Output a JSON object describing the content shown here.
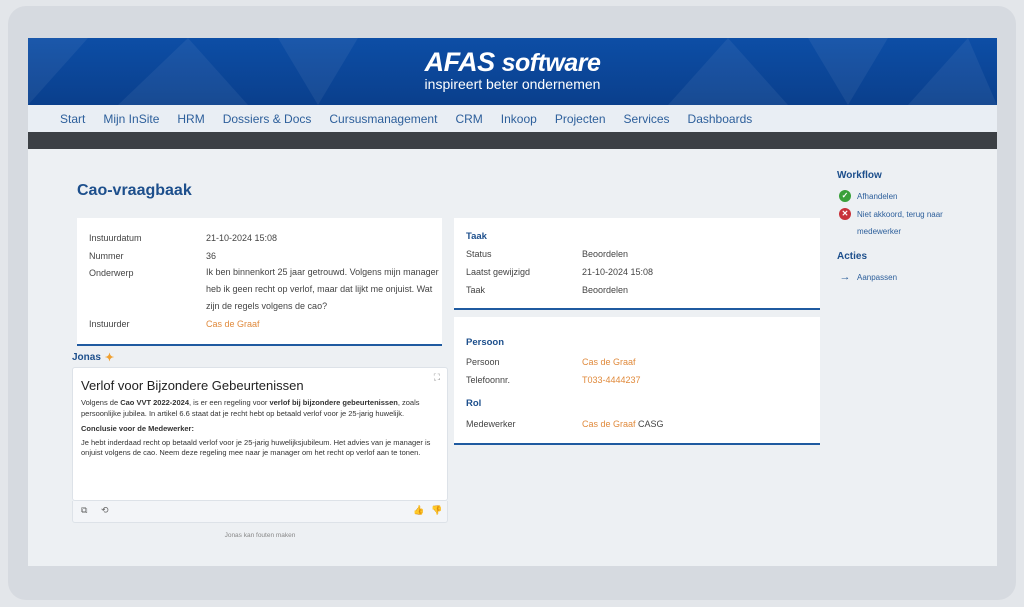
{
  "brand": {
    "name": "AFAS",
    "software": "software",
    "tagline": "inspireert beter ondernemen"
  },
  "nav": [
    "Start",
    "Mijn InSite",
    "HRM",
    "Dossiers & Docs",
    "Cursusmanagement",
    "CRM",
    "Inkoop",
    "Projecten",
    "Services",
    "Dashboards"
  ],
  "page": {
    "title": "Cao-vraagbaak"
  },
  "request": {
    "instuurdatum_label": "Instuurdatum",
    "instuurdatum": "21-10-2024 15:08",
    "nummer_label": "Nummer",
    "nummer": "36",
    "onderwerp_label": "Onderwerp",
    "onderwerp": "Ik ben binnenkort 25 jaar getrouwd. Volgens mijn manager heb ik geen recht op verlof, maar dat lijkt me onjuist. Wat zijn de regels volgens de cao?",
    "instuurder_label": "Instuurder",
    "instuurder": "Cas de Graaf"
  },
  "taak": {
    "title": "Taak",
    "status_label": "Status",
    "status": "Beoordelen",
    "gewijzigd_label": "Laatst gewijzigd",
    "gewijzigd": "21-10-2024 15:08",
    "taak_label": "Taak",
    "taak": "Beoordelen"
  },
  "persoon": {
    "title": "Persoon",
    "persoon_label": "Persoon",
    "persoon": "Cas de Graaf",
    "telefoon_label": "Telefoonnr.",
    "telefoon": "T033-4444237",
    "rol_title": "Rol",
    "medewerker_label": "Medewerker",
    "medewerker": "Cas de Graaf",
    "medewerker_code": "CASG"
  },
  "jonas": {
    "label": "Jonas",
    "heading": "Verlof voor Bijzondere Gebeurtenissen",
    "p1_a": "Volgens de ",
    "p1_b": "Cao VVT 2022-2024",
    "p1_c": ", is er een regeling voor ",
    "p1_d": "verlof bij bijzondere gebeurtenissen",
    "p1_e": ", zoals persoonlijke jubilea. In artikel 6.6 staat dat je recht hebt op betaald verlof voor je 25-jarig huwelijk.",
    "conclusion_title": "Conclusie voor de Medewerker:",
    "conclusion": "Je hebt inderdaad recht op betaald verlof voor je 25-jarig huwelijksjubileum. Het advies van je manager is onjuist volgens de cao. Neem deze regeling mee naar je manager om het recht op verlof aan te tonen.",
    "disclaimer": "Jonas kan fouten maken"
  },
  "workflow": {
    "title": "Workflow",
    "afhandelen": "Afhandelen",
    "niet_akkoord": "Niet akkoord, terug naar medewerker"
  },
  "acties": {
    "title": "Acties",
    "aanpassen": "Aanpassen"
  },
  "colors": {
    "brand_blue": "#0d4ea6",
    "link_orange": "#e08a3c",
    "success_green": "#3aa03a",
    "error_red": "#c8323a"
  }
}
